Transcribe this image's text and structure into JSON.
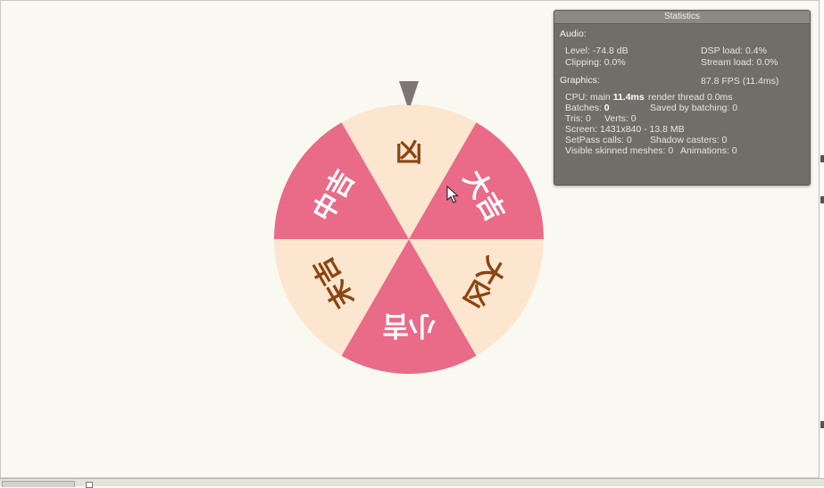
{
  "wheel": {
    "segments": [
      {
        "label": "凶",
        "color": "#fde6cf",
        "text_color": "#8a4512"
      },
      {
        "label": "大吉",
        "color": "#e96b88",
        "text_color": "#ffffff"
      },
      {
        "label": "大凶",
        "color": "#fde6cf",
        "text_color": "#8a4512"
      },
      {
        "label": "小吉",
        "color": "#e96b88",
        "text_color": "#ffffff"
      },
      {
        "label": "末吉",
        "color": "#fde6cf",
        "text_color": "#8a4512"
      },
      {
        "label": "中吉",
        "color": "#e96b88",
        "text_color": "#ffffff"
      }
    ],
    "pointer_color": "#7d7578"
  },
  "stats": {
    "title": "Statistics",
    "audio_header": "Audio:",
    "level": "Level: -74.8 dB",
    "dsp_load": "DSP load: 0.4%",
    "clipping": "Clipping: 0.0%",
    "stream_load": "Stream load: 0.0%",
    "graphics_header": "Graphics:",
    "fps": "87.8 FPS (11.4ms)",
    "cpu_prefix": "CPU: main ",
    "cpu_main": "11.4ms",
    "render_thread": "render thread 0.0ms",
    "batches_prefix": "Batches: ",
    "batches": "0",
    "saved_batching_prefix": "Saved by batching: ",
    "saved_batching": "0",
    "tris": "Tris: 0",
    "verts": "Verts: 0",
    "screen": "Screen: 1431x840 - 13.8 MB",
    "setpass": "SetPass calls: 0",
    "shadow_casters": "Shadow casters: 0",
    "skinned_meshes": "Visible skinned meshes: 0",
    "animations": "Animations: 0"
  }
}
